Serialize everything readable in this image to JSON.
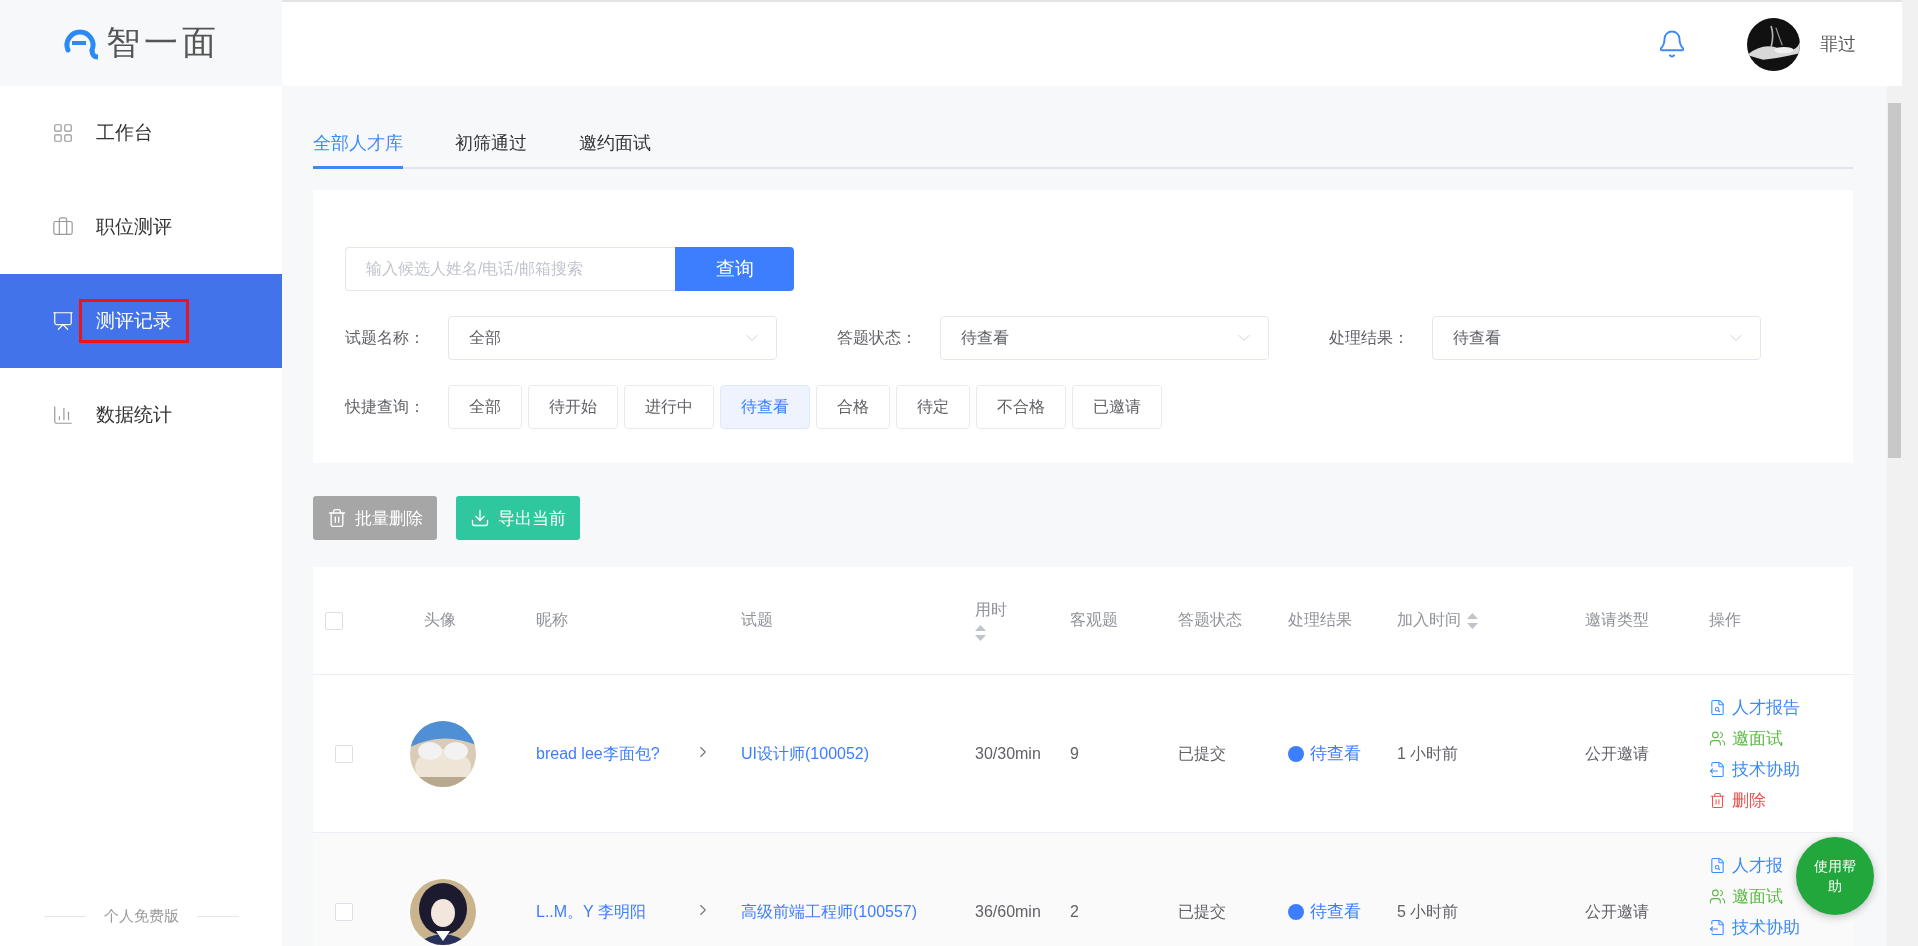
{
  "logo": {
    "text": "智一面"
  },
  "sidebar": {
    "items": [
      {
        "label": "工作台",
        "selected": false,
        "outlined": false
      },
      {
        "label": "职位测评",
        "selected": false,
        "outlined": false
      },
      {
        "label": "测评记录",
        "selected": true,
        "outlined": true
      },
      {
        "label": "数据统计",
        "selected": false,
        "outlined": false
      }
    ],
    "footer": "个人免费版"
  },
  "header": {
    "user_name": "罪过"
  },
  "tabs": [
    {
      "label": "全部人才库",
      "selected": true
    },
    {
      "label": "初筛通过",
      "selected": false
    },
    {
      "label": "邀约面试",
      "selected": false
    }
  ],
  "filters": {
    "search": {
      "placeholder": "输入候选人姓名/电话/邮箱搜索",
      "button": "查询"
    },
    "selects": [
      {
        "label": "试题名称：",
        "value": "全部"
      },
      {
        "label": "答题状态：",
        "value": "待查看"
      },
      {
        "label": "处理结果：",
        "value": "待查看"
      }
    ],
    "quick": {
      "label": "快捷查询：",
      "options": [
        {
          "label": "全部",
          "selected": false
        },
        {
          "label": "待开始",
          "selected": false
        },
        {
          "label": "进行中",
          "selected": false
        },
        {
          "label": "待查看",
          "selected": true
        },
        {
          "label": "合格",
          "selected": false
        },
        {
          "label": "待定",
          "selected": false
        },
        {
          "label": "不合格",
          "selected": false
        },
        {
          "label": "已邀请",
          "selected": false
        }
      ]
    }
  },
  "actions": [
    {
      "label": "批量删除",
      "kind": "delete"
    },
    {
      "label": "导出当前",
      "kind": "export"
    }
  ],
  "table": {
    "header_checkbox": {
      "checked": false
    },
    "columns": [
      {
        "label": "头像",
        "sortable": false
      },
      {
        "label": "昵称",
        "sortable": false
      },
      {
        "label": "试题",
        "sortable": false
      },
      {
        "label": "用时",
        "sortable": true
      },
      {
        "label": "客观题",
        "sortable": false
      },
      {
        "label": "答题状态",
        "sortable": false
      },
      {
        "label": "处理结果",
        "sortable": false
      },
      {
        "label": "加入时间",
        "sortable": true
      },
      {
        "label": "邀请类型",
        "sortable": false
      },
      {
        "label": "操作",
        "sortable": false
      }
    ],
    "rows": [
      {
        "checked": false,
        "nickname": "bread lee李面包?",
        "question": "UI设计师(100052)",
        "duration": "30/30min",
        "objective": "9",
        "status": "已提交",
        "result": {
          "label": "待查看",
          "color": "#3d7eff"
        },
        "joined": "1 小时前",
        "invite": "公开邀请",
        "actions": [
          {
            "label": "人才报告",
            "kind": "report"
          },
          {
            "label": "邀面试",
            "kind": "invite"
          },
          {
            "label": "技术协助",
            "kind": "assist"
          },
          {
            "label": "删除",
            "kind": "delete"
          }
        ]
      },
      {
        "checked": false,
        "nickname": "L..M。Y 李明阳",
        "question": "高级前端工程师(100557)",
        "duration": "36/60min",
        "objective": "2",
        "status": "已提交",
        "result": {
          "label": "待查看",
          "color": "#3d7eff"
        },
        "joined": "5 小时前",
        "invite": "公开邀请",
        "actions": [
          {
            "label": "人才报",
            "kind": "report"
          },
          {
            "label": "邀面试",
            "kind": "invite"
          },
          {
            "label": "技术协助",
            "kind": "assist"
          }
        ]
      }
    ]
  },
  "help_button": {
    "label": "使用帮助"
  }
}
